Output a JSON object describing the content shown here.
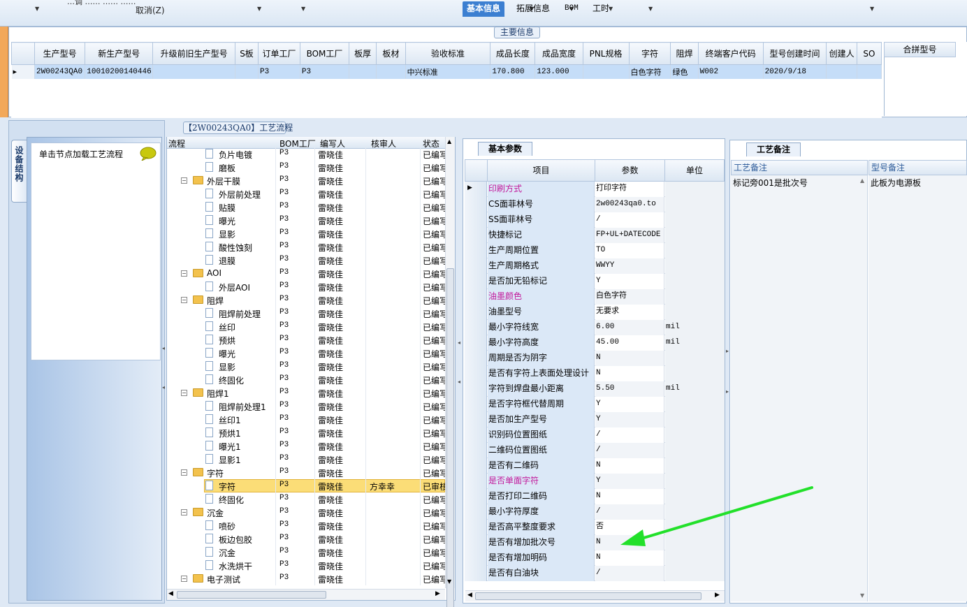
{
  "toolbar": {
    "partial_text": "…调 ……  ……  ……",
    "cancel_label": "取消(Z)"
  },
  "main_info": {
    "title": "主要信息",
    "columns": [
      "生产型号",
      "新生产型号",
      "升级前旧生产型号",
      "S板",
      "订单工厂",
      "BOM工厂",
      "板厚",
      "板材",
      "验收标准",
      "成品长度",
      "成品宽度",
      "PNL规格",
      "字符",
      "阻焊",
      "终端客户代码",
      "型号创建时间",
      "创建人",
      "SO"
    ],
    "row": [
      "2W00243QA0",
      "10010200140446",
      "",
      "",
      "P3",
      "P3",
      "",
      "",
      "中兴标准",
      "170.800",
      "123.000",
      "",
      "白色字符",
      "绿色",
      "W002",
      "2020/9/18",
      "",
      ""
    ],
    "merge_label": "合拼型号"
  },
  "left_panel": {
    "vertical_tab": "设备结构",
    "hint": "单击节点加载工艺流程"
  },
  "tree": {
    "title": "【2W00243QA0】工艺流程",
    "columns": [
      "流程",
      "BOM工厂",
      "编写人",
      "核审人",
      "状态"
    ],
    "rows": [
      {
        "name": "负片电镀",
        "level": 2,
        "bom": "P3",
        "writer": "雷晓佳",
        "reviewer": "",
        "status": "已编写"
      },
      {
        "name": "磨板",
        "level": 2,
        "bom": "P3",
        "writer": "雷晓佳",
        "reviewer": "",
        "status": "已编写"
      },
      {
        "name": "外层干膜",
        "level": 1,
        "bom": "P3",
        "writer": "雷晓佳",
        "reviewer": "",
        "status": "已编写"
      },
      {
        "name": "外层前处理",
        "level": 2,
        "bom": "P3",
        "writer": "雷晓佳",
        "reviewer": "",
        "status": "已编写"
      },
      {
        "name": "贴膜",
        "level": 2,
        "bom": "P3",
        "writer": "雷晓佳",
        "reviewer": "",
        "status": "已编写"
      },
      {
        "name": "曝光",
        "level": 2,
        "bom": "P3",
        "writer": "雷晓佳",
        "reviewer": "",
        "status": "已编写"
      },
      {
        "name": "显影",
        "level": 2,
        "bom": "P3",
        "writer": "雷晓佳",
        "reviewer": "",
        "status": "已编写"
      },
      {
        "name": "酸性蚀刻",
        "level": 2,
        "bom": "P3",
        "writer": "雷晓佳",
        "reviewer": "",
        "status": "已编写"
      },
      {
        "name": "退膜",
        "level": 2,
        "bom": "P3",
        "writer": "雷晓佳",
        "reviewer": "",
        "status": "已编写"
      },
      {
        "name": "AOI",
        "level": 1,
        "bom": "P3",
        "writer": "雷晓佳",
        "reviewer": "",
        "status": "已编写"
      },
      {
        "name": "外层AOI",
        "level": 2,
        "bom": "P3",
        "writer": "雷晓佳",
        "reviewer": "",
        "status": "已编写"
      },
      {
        "name": "阻焊",
        "level": 1,
        "bom": "P3",
        "writer": "雷晓佳",
        "reviewer": "",
        "status": "已编写"
      },
      {
        "name": "阻焊前处理",
        "level": 2,
        "bom": "P3",
        "writer": "雷晓佳",
        "reviewer": "",
        "status": "已编写"
      },
      {
        "name": "丝印",
        "level": 2,
        "bom": "P3",
        "writer": "雷晓佳",
        "reviewer": "",
        "status": "已编写"
      },
      {
        "name": "预烘",
        "level": 2,
        "bom": "P3",
        "writer": "雷晓佳",
        "reviewer": "",
        "status": "已编写"
      },
      {
        "name": "曝光",
        "level": 2,
        "bom": "P3",
        "writer": "雷晓佳",
        "reviewer": "",
        "status": "已编写"
      },
      {
        "name": "显影",
        "level": 2,
        "bom": "P3",
        "writer": "雷晓佳",
        "reviewer": "",
        "status": "已编写"
      },
      {
        "name": "终固化",
        "level": 2,
        "bom": "P3",
        "writer": "雷晓佳",
        "reviewer": "",
        "status": "已编写"
      },
      {
        "name": "阻焊1",
        "level": 1,
        "bom": "P3",
        "writer": "雷晓佳",
        "reviewer": "",
        "status": "已编写"
      },
      {
        "name": "阻焊前处理1",
        "level": 2,
        "bom": "P3",
        "writer": "雷晓佳",
        "reviewer": "",
        "status": "已编写"
      },
      {
        "name": "丝印1",
        "level": 2,
        "bom": "P3",
        "writer": "雷晓佳",
        "reviewer": "",
        "status": "已编写"
      },
      {
        "name": "预烘1",
        "level": 2,
        "bom": "P3",
        "writer": "雷晓佳",
        "reviewer": "",
        "status": "已编写"
      },
      {
        "name": "曝光1",
        "level": 2,
        "bom": "P3",
        "writer": "雷晓佳",
        "reviewer": "",
        "status": "已编写"
      },
      {
        "name": "显影1",
        "level": 2,
        "bom": "P3",
        "writer": "雷晓佳",
        "reviewer": "",
        "status": "已编写"
      },
      {
        "name": "字符",
        "level": 1,
        "bom": "P3",
        "writer": "雷晓佳",
        "reviewer": "",
        "status": "已编写"
      },
      {
        "name": "字符",
        "level": 2,
        "bom": "P3",
        "writer": "雷晓佳",
        "reviewer": "方幸幸",
        "status": "已审核",
        "selected": true
      },
      {
        "name": "终固化",
        "level": 2,
        "bom": "P3",
        "writer": "雷晓佳",
        "reviewer": "",
        "status": "已编写"
      },
      {
        "name": "沉金",
        "level": 1,
        "bom": "P3",
        "writer": "雷晓佳",
        "reviewer": "",
        "status": "已编写"
      },
      {
        "name": "喷砂",
        "level": 2,
        "bom": "P3",
        "writer": "雷晓佳",
        "reviewer": "",
        "status": "已编写"
      },
      {
        "name": "板边包胶",
        "level": 2,
        "bom": "P3",
        "writer": "雷晓佳",
        "reviewer": "",
        "status": "已编写"
      },
      {
        "name": "沉金",
        "level": 2,
        "bom": "P3",
        "writer": "雷晓佳",
        "reviewer": "",
        "status": "已编写"
      },
      {
        "name": "水洗烘干",
        "level": 2,
        "bom": "P3",
        "writer": "雷晓佳",
        "reviewer": "",
        "status": "已编写"
      },
      {
        "name": "电子测试",
        "level": 1,
        "bom": "P3",
        "writer": "雷晓佳",
        "reviewer": "",
        "status": "已编写"
      }
    ]
  },
  "right_tabs": [
    "基本信息",
    "拓展信息",
    "BOM",
    "工时"
  ],
  "params": {
    "tab_label": "基本参数",
    "columns": [
      "项目",
      "参数",
      "单位"
    ],
    "rows": [
      {
        "item": "印刷方式",
        "value": "打印字符",
        "unit": "",
        "pink": true,
        "current": true
      },
      {
        "item": "CS面菲林号",
        "value": "2w00243qa0.to",
        "unit": ""
      },
      {
        "item": "SS面菲林号",
        "value": "/",
        "unit": ""
      },
      {
        "item": "快捷标记",
        "value": "FP+UL+DATECODE",
        "unit": ""
      },
      {
        "item": "生产周期位置",
        "value": "TO",
        "unit": ""
      },
      {
        "item": "生产周期格式",
        "value": "WWYY",
        "unit": ""
      },
      {
        "item": "是否加无铅标记",
        "value": "Y",
        "unit": ""
      },
      {
        "item": "油墨颜色",
        "value": "白色字符",
        "unit": "",
        "pink": true
      },
      {
        "item": "油墨型号",
        "value": "无要求",
        "unit": ""
      },
      {
        "item": "最小字符线宽",
        "value": "6.00",
        "unit": "mil"
      },
      {
        "item": "最小字符高度",
        "value": "45.00",
        "unit": "mil"
      },
      {
        "item": "周期是否为阴字",
        "value": "N",
        "unit": ""
      },
      {
        "item": "是否有字符上表面处理设计",
        "value": "N",
        "unit": ""
      },
      {
        "item": "字符到焊盘最小距离",
        "value": "5.50",
        "unit": "mil"
      },
      {
        "item": "是否字符框代替周期",
        "value": "Y",
        "unit": ""
      },
      {
        "item": "是否加生产型号",
        "value": "Y",
        "unit": ""
      },
      {
        "item": "识别码位置图纸",
        "value": "/",
        "unit": ""
      },
      {
        "item": "二维码位置图纸",
        "value": "/",
        "unit": ""
      },
      {
        "item": "是否有二维码",
        "value": "N",
        "unit": ""
      },
      {
        "item": "是否单面字符",
        "value": "Y",
        "unit": "",
        "pink": true
      },
      {
        "item": "是否打印二维码",
        "value": "N",
        "unit": ""
      },
      {
        "item": "最小字符厚度",
        "value": "/",
        "unit": ""
      },
      {
        "item": "是否高平整度要求",
        "value": "否",
        "unit": ""
      },
      {
        "item": "是否有增加批次号",
        "value": "N",
        "unit": ""
      },
      {
        "item": "是否有增加明码",
        "value": "N",
        "unit": ""
      },
      {
        "item": "是否有白油块",
        "value": "/",
        "unit": ""
      }
    ]
  },
  "remarks": {
    "tab_label": "工艺备注",
    "col1_header": "工艺备注",
    "col2_header": "型号备注",
    "col1_text": "标记旁001是批次号",
    "col2_text": "此板为电源板"
  },
  "colors": {
    "accent_tab": "#3c7fd1",
    "selected_row": "#fbdd77",
    "pink_label": "#c2189b",
    "annotation_arrow": "#22e02a"
  }
}
